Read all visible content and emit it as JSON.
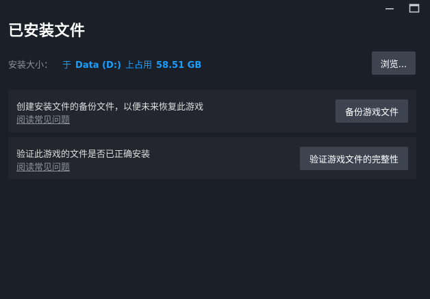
{
  "window": {
    "minimize_icon": "minimize-icon",
    "maximize_icon": "maximize-icon"
  },
  "page": {
    "title": "已安装文件"
  },
  "install_size": {
    "label": "安装大小：",
    "prefix": "于",
    "drive": "Data (D:)",
    "mid": "上占用",
    "value": "58.51 GB"
  },
  "browse_button": {
    "label": "浏览..."
  },
  "panels": [
    {
      "description": "创建安装文件的备份文件，以便未来恢复此游戏",
      "link": "阅读常见问题",
      "button": "备份游戏文件"
    },
    {
      "description": "验证此游戏的文件是否已正确安装",
      "link": "阅读常见问题",
      "button": "验证游戏文件的完整性"
    }
  ],
  "colors": {
    "background": "#1b1f27",
    "panel": "#23262e",
    "button": "#3d4450",
    "accent": "#1a9fff",
    "muted": "#8b929a"
  }
}
